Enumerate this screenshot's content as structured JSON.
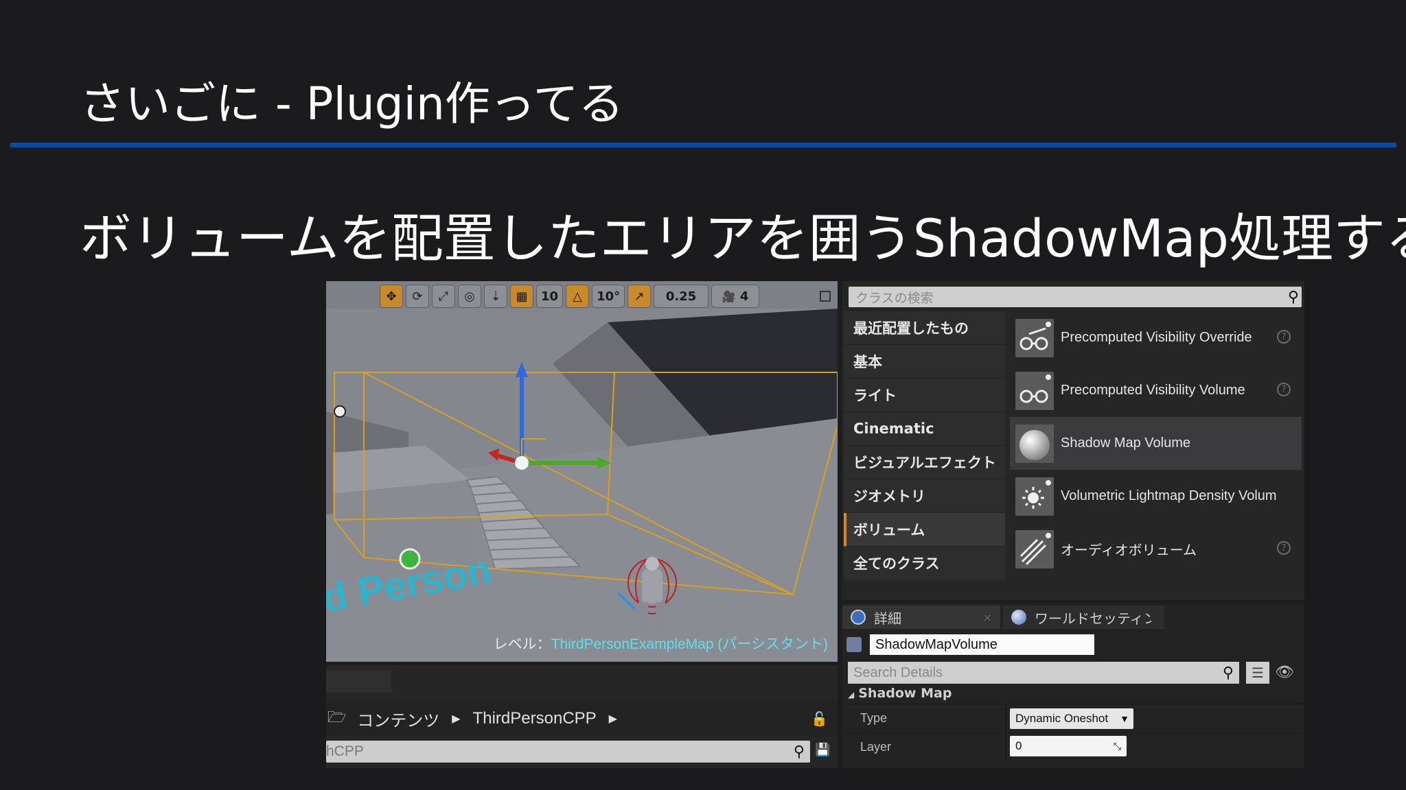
{
  "slide": {
    "title": "さいごに - Plugin作ってる",
    "subtitle": "ボリュームを配置したエリアを囲うShadowMap処理する",
    "accent_color": "#0e4a9e"
  },
  "viewport": {
    "toolbar": {
      "translate_icon": "move-icon",
      "rotate_icon": "rotate-icon",
      "scale_icon": "scale-icon",
      "grid_snap_value": "10",
      "rotation_snap_value": "10°",
      "scale_snap_value": "0.25",
      "camera_speed_value": "4"
    },
    "level_prefix": "レベル：",
    "level_name": "ThirdPersonExampleMap (パーシスタント)",
    "floor_text": "d Person"
  },
  "content_browser": {
    "path": [
      "コンテンツ",
      "ThirdPersonCPP"
    ],
    "search_value": "hCPP"
  },
  "place_actors": {
    "search_placeholder": "クラスの検索",
    "categories": [
      {
        "label": "最近配置したもの"
      },
      {
        "label": "基本"
      },
      {
        "label": "ライト"
      },
      {
        "label": "Cinematic"
      },
      {
        "label": "ビジュアルエフェクト"
      },
      {
        "label": "ジオメトリ"
      },
      {
        "label": "ボリューム",
        "active": true
      },
      {
        "label": "全てのクラス"
      }
    ],
    "actors": [
      {
        "label": "Precomputed Visibility Override",
        "icon": "visibility-override-icon"
      },
      {
        "label": "Precomputed Visibility Volume",
        "icon": "visibility-volume-icon"
      },
      {
        "label": "Shadow Map Volume",
        "icon": "sphere-icon",
        "selected": true
      },
      {
        "label": "Volumetric Lightmap Density Volum",
        "icon": "lightmap-density-icon"
      },
      {
        "label": "オーディオボリューム",
        "icon": "audio-volume-icon"
      }
    ]
  },
  "details": {
    "tab_details": "詳細",
    "tab_world_settings": "ワールドセッティング",
    "actor_name": "ShadowMapVolume",
    "search_placeholder": "Search Details",
    "section": "Shadow Map",
    "properties": [
      {
        "name": "Type",
        "value": "Dynamic Oneshot"
      },
      {
        "name": "Layer",
        "value": "0"
      }
    ]
  }
}
